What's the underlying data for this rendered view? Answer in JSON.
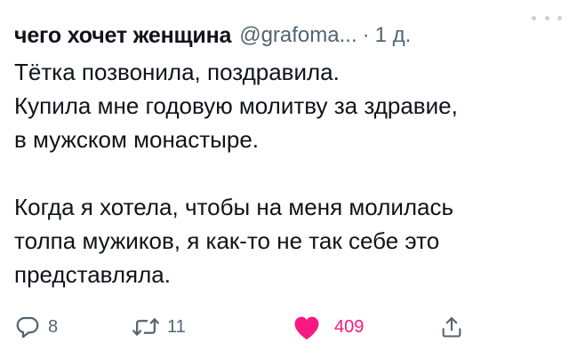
{
  "tweet": {
    "author_name": "чего хочет женщина",
    "handle": "@grafoma...",
    "separator": "·",
    "time": "1 д.",
    "body_lines": [
      "Тётка позвонила, поздравила.",
      "Купила мне годовую молитву за здравие,",
      "в мужском монастыре.",
      "",
      "Когда я хотела, чтобы на меня молилась",
      "толпа мужиков, я как-то не так себе это",
      "представляла."
    ],
    "actions": {
      "reply_count": "8",
      "retweet_count": "11",
      "like_count": "409"
    }
  },
  "colors": {
    "text": "#0f1419",
    "muted": "#536471",
    "like": "#f91880"
  },
  "icons": {
    "more": "more-dots-icon",
    "reply": "reply-bubble-icon",
    "retweet": "retweet-arrows-icon",
    "like": "heart-filled-icon",
    "share": "share-upload-icon"
  }
}
